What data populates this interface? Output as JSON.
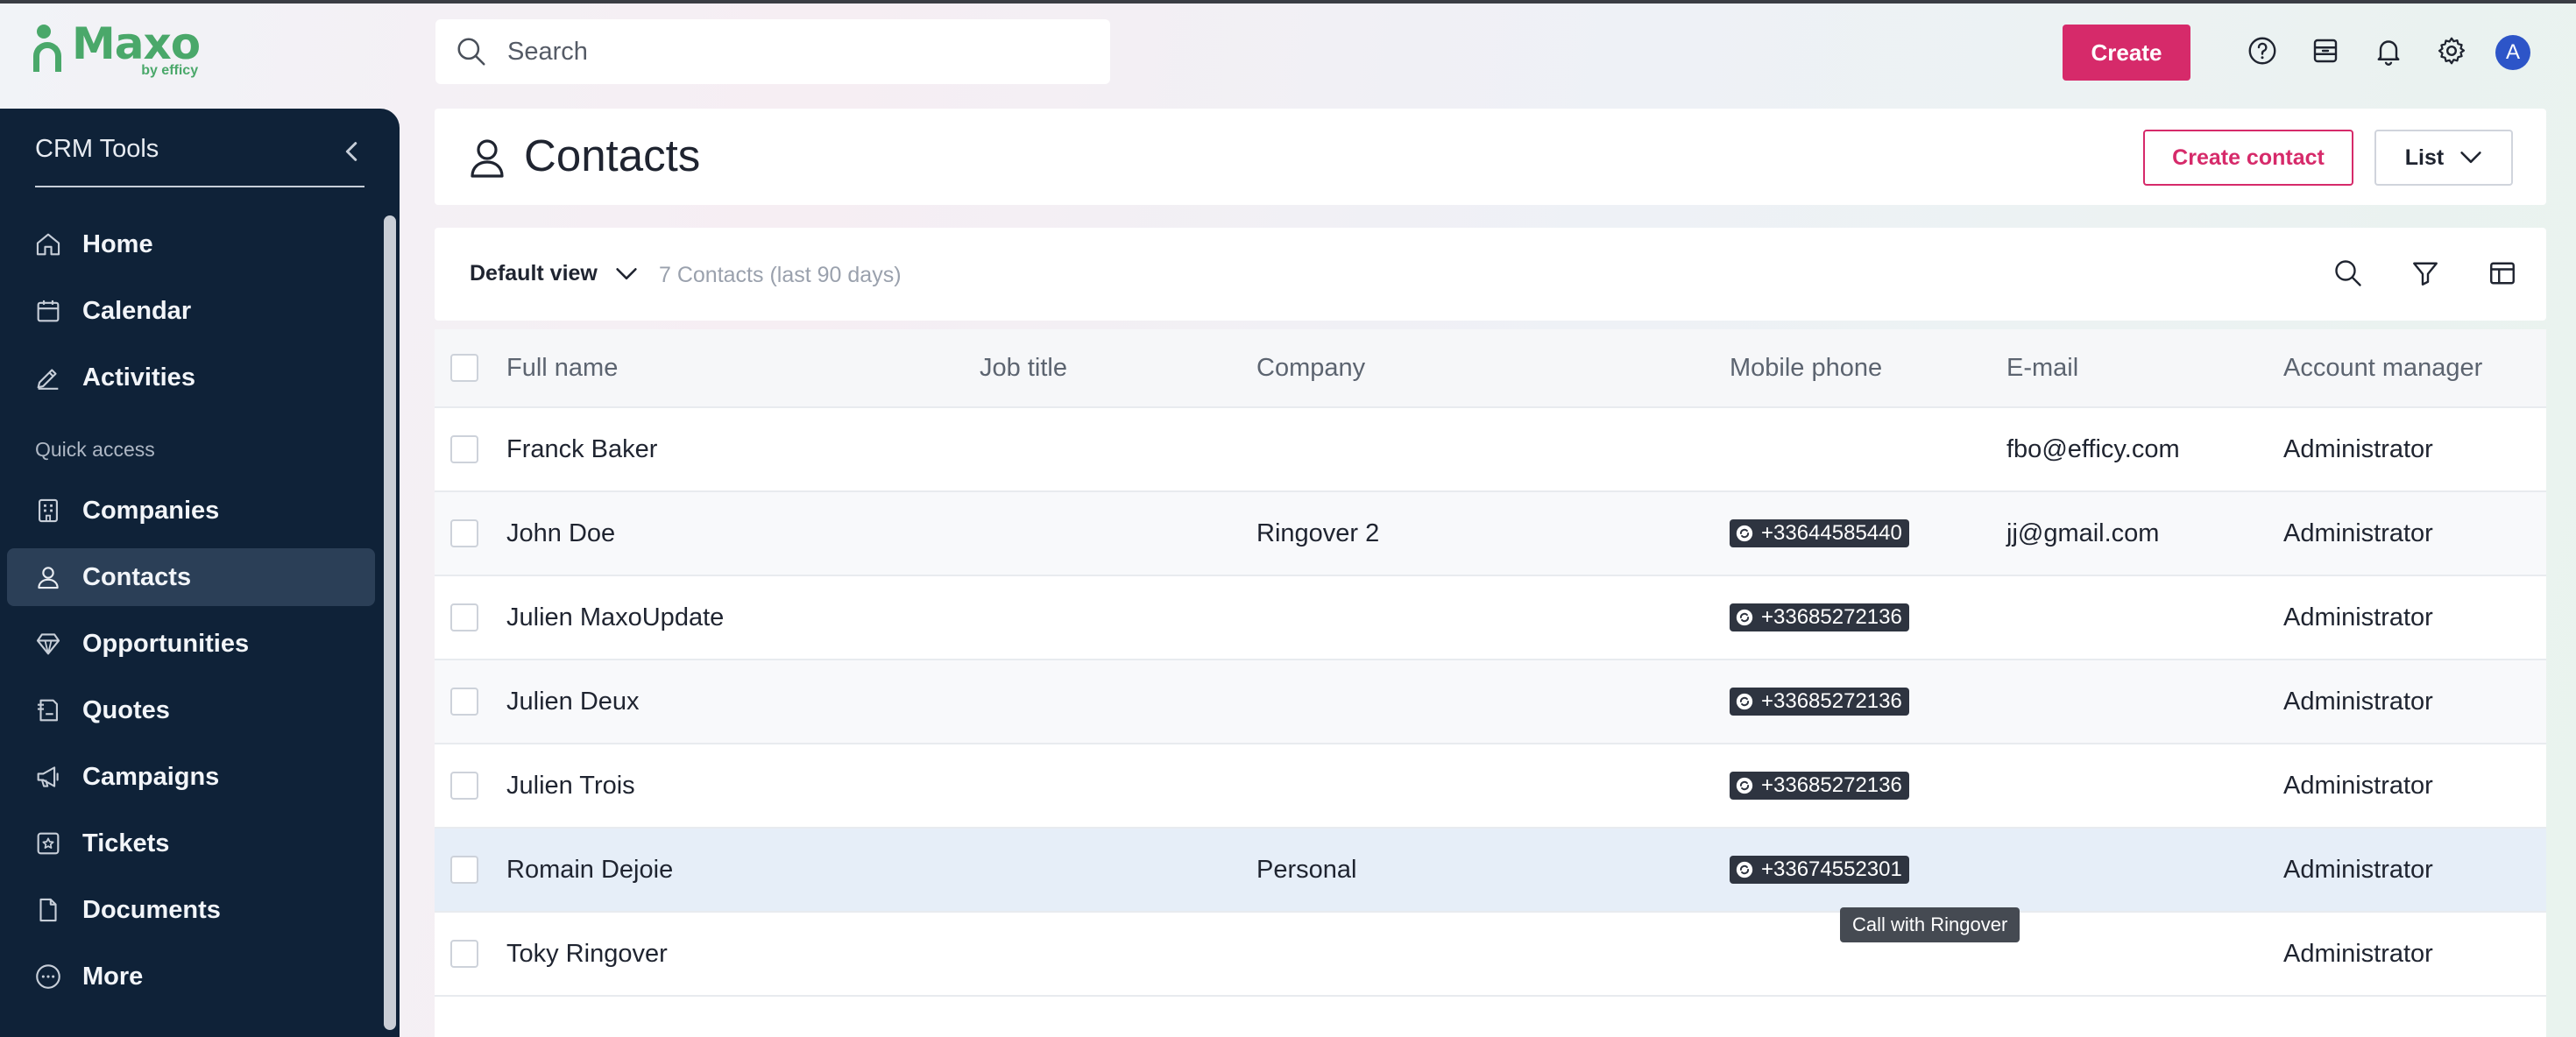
{
  "brand": {
    "name": "Maxo",
    "by": "by efficy",
    "color": "#4aa86a"
  },
  "topbar": {
    "search_placeholder": "Search",
    "create_label": "Create",
    "accent": "#d62a6a",
    "icons": [
      "help-icon",
      "archive-icon",
      "bell-icon",
      "gear-icon"
    ],
    "avatar_initial": "A"
  },
  "sidebar": {
    "title": "CRM Tools",
    "items_top": [
      {
        "label": "Home",
        "icon": "home-icon"
      },
      {
        "label": "Calendar",
        "icon": "calendar-icon"
      },
      {
        "label": "Activities",
        "icon": "activities-icon"
      }
    ],
    "section_label": "Quick access",
    "items_quick": [
      {
        "label": "Companies",
        "icon": "building-icon"
      },
      {
        "label": "Contacts",
        "icon": "contact-icon",
        "active": true
      },
      {
        "label": "Opportunities",
        "icon": "diamond-icon"
      },
      {
        "label": "Quotes",
        "icon": "quote-icon"
      },
      {
        "label": "Campaigns",
        "icon": "megaphone-icon"
      },
      {
        "label": "Tickets",
        "icon": "ticket-icon"
      },
      {
        "label": "Documents",
        "icon": "document-icon"
      },
      {
        "label": "More",
        "icon": "more-icon"
      }
    ]
  },
  "header": {
    "title": "Contacts",
    "create_contact_label": "Create contact",
    "list_label": "List"
  },
  "view_bar": {
    "view_label": "Default view",
    "count_label": "7 Contacts (last 90 days)"
  },
  "table": {
    "columns": [
      "Full name",
      "Job title",
      "Company",
      "Mobile phone",
      "E-mail",
      "Account manager"
    ],
    "rows": [
      {
        "name": "Franck Baker",
        "job": "",
        "company": "",
        "phone": "",
        "email": "fbo@efficy.com",
        "manager": "Administrator"
      },
      {
        "name": "John Doe",
        "job": "",
        "company": "Ringover 2",
        "phone": "+33644585440",
        "email": "jj@gmail.com",
        "manager": "Administrator"
      },
      {
        "name": "Julien MaxoUpdate",
        "job": "",
        "company": "",
        "phone": "+33685272136",
        "email": "",
        "manager": "Administrator"
      },
      {
        "name": "Julien Deux",
        "job": "",
        "company": "",
        "phone": "+33685272136",
        "email": "",
        "manager": "Administrator"
      },
      {
        "name": "Julien Trois",
        "job": "",
        "company": "",
        "phone": "+33685272136",
        "email": "",
        "manager": "Administrator"
      },
      {
        "name": "Romain Dejoie",
        "job": "",
        "company": "Personal",
        "phone": "+33674552301",
        "email": "",
        "manager": "Administrator",
        "hovered": true
      },
      {
        "name": "Toky Ringover",
        "job": "",
        "company": "",
        "phone": "",
        "email": "",
        "manager": "Administrator"
      }
    ]
  },
  "tooltip": {
    "text": "Call with Ringover"
  }
}
